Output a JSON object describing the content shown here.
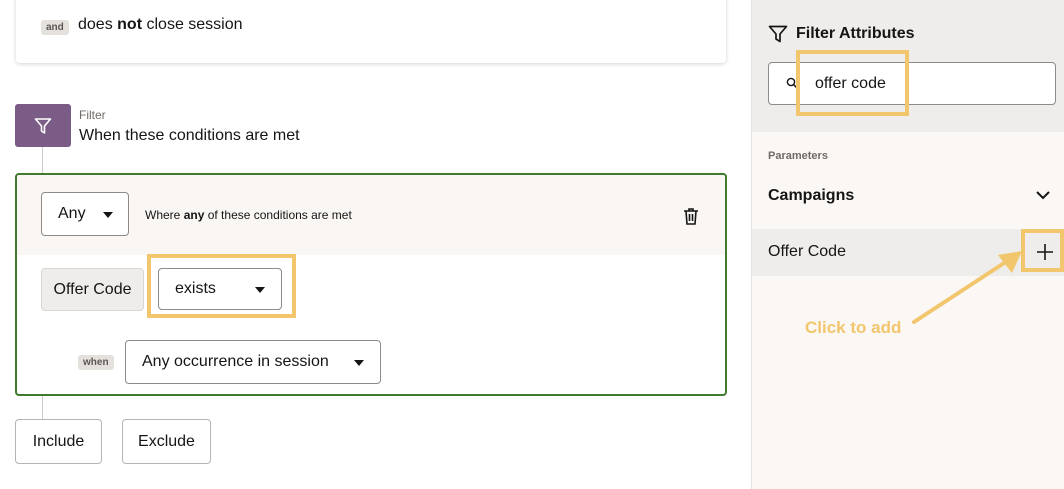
{
  "flow": {
    "prev_condition": {
      "connector_label": "and",
      "text_before": "does",
      "text_bold": "not",
      "text_after": "close session"
    },
    "filter": {
      "label": "Filter",
      "title": "When these conditions are met"
    },
    "group": {
      "match_select": "Any",
      "where_before": "Where",
      "where_bold": "any",
      "where_after": "of these conditions are met",
      "condition": {
        "attribute": "Offer Code",
        "operator": "exists",
        "when_label": "when",
        "occurrence": "Any occurrence in session"
      }
    },
    "buttons": {
      "include": "Include",
      "exclude": "Exclude"
    }
  },
  "panel": {
    "title": "Filter Attributes",
    "search_value": "offer code",
    "section_label": "Parameters",
    "category": "Campaigns",
    "item_label": "Offer Code"
  },
  "annotation": {
    "callout": "Click to add",
    "highlight_color": "#f2c66d"
  },
  "colors": {
    "filter_icon_bg": "#7a5c86",
    "group_border": "#3f7a2e"
  }
}
